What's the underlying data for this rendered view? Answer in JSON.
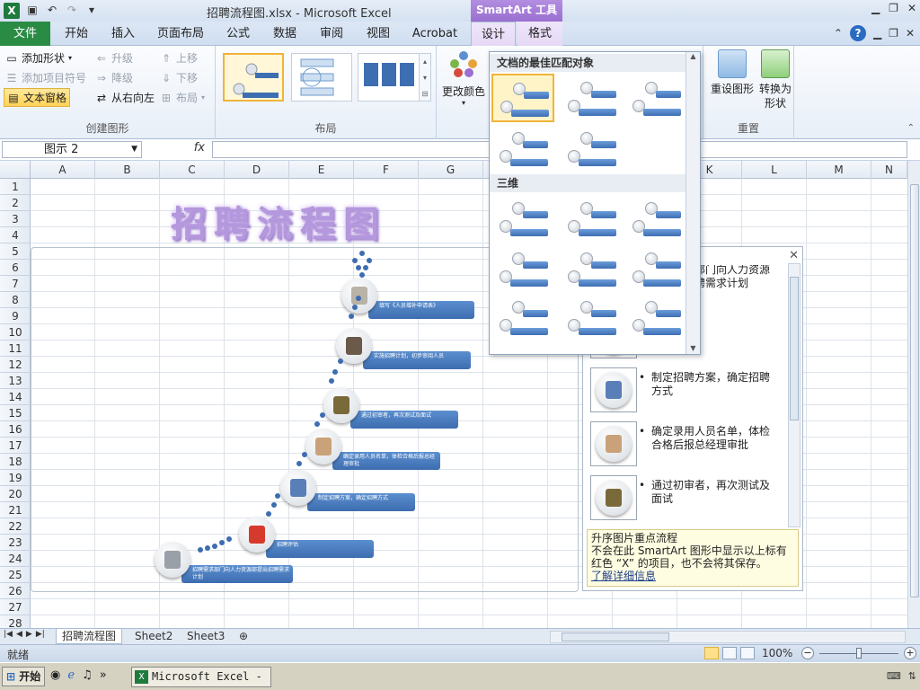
{
  "window": {
    "app_icon": "X",
    "title": "招聘流程图.xlsx  -  Microsoft Excel",
    "contextual_tab_group": "SmartArt 工具",
    "controls": [
      "minimize-icon",
      "restore-icon",
      "close-icon"
    ]
  },
  "quick_access": {
    "save": "save-icon",
    "undo": "undo-icon",
    "redo": "redo-icon",
    "customize": "dropdown-icon"
  },
  "tabs": {
    "file": "文件",
    "items": [
      "开始",
      "插入",
      "页面布局",
      "公式",
      "数据",
      "审阅",
      "视图",
      "Acrobat",
      "设计",
      "格式"
    ],
    "active": "设计"
  },
  "ribbon": {
    "create_graphic": {
      "label": "创建图形",
      "add_shape": "添加形状",
      "add_bullet": "添加项目符号",
      "text_pane": "文本窗格",
      "promote": "升级",
      "demote": "降级",
      "right_to_left": "从右向左",
      "move_up": "上移",
      "move_down": "下移",
      "layout": "布局"
    },
    "layouts": {
      "label": "布局"
    },
    "change_colors": "更改颜色",
    "reset": {
      "label": "重置",
      "reset_graphic": "重设图形",
      "convert_1": "转换为",
      "convert_2": "形状"
    }
  },
  "formula_bar": {
    "name_box": "图示 2",
    "fx": "fx",
    "value": ""
  },
  "grid": {
    "columns": [
      "A",
      "B",
      "C",
      "D",
      "E",
      "F",
      "G",
      "H",
      "I",
      "J",
      "K",
      "L",
      "M",
      "N"
    ],
    "rows": [
      "1",
      "2",
      "3",
      "4",
      "5",
      "6",
      "7",
      "8",
      "9",
      "10",
      "11",
      "12",
      "13",
      "14",
      "15",
      "16",
      "17",
      "18",
      "19",
      "20",
      "21",
      "22",
      "23",
      "24",
      "25",
      "26",
      "27",
      "28"
    ]
  },
  "wordart_title": "招聘流程图",
  "smartart": {
    "steps": [
      {
        "text": "招聘需求部门向人力资源部提出招聘需求计划",
        "color": "#9aa0a8"
      },
      {
        "text": "招聘评估",
        "color": "#d63a2c"
      },
      {
        "text": "制定招聘方案，确定招聘方式",
        "color": "#5a7fb8"
      },
      {
        "text": "确定录用人员名单，体检合格后报总经理审批",
        "color": "#c9a27a"
      },
      {
        "text": "通过初审者，再次测试及面试",
        "color": "#7a6a3a"
      },
      {
        "text": "实施招聘计划，初步审阅人员",
        "color": "#6b5a4a"
      },
      {
        "text": "填写《人员增补申请表》",
        "color": "#b9b2a6"
      }
    ]
  },
  "text_pane": {
    "items": [
      {
        "text": "招聘需求部门向人力资源部提出招聘需求计划",
        "color": "#9aa0a8"
      },
      {
        "text": "招聘评估",
        "color": "#d63a2c"
      },
      {
        "text": "制定招聘方案，确定招聘方式",
        "color": "#5a7fb8"
      },
      {
        "text": "确定录用人员名单，体检合格后报总经理审批",
        "color": "#c9a27a"
      },
      {
        "text": "通过初审者，再次测试及面试",
        "color": "#7a6a3a"
      }
    ],
    "info_title": "升序图片重点流程",
    "info_body": "不会在此 SmartArt 图形中显示以上标有红色 “X” 的项目，也不会将其保存。",
    "info_link": "了解详细信息"
  },
  "gallery": {
    "section_best": "文档的最佳匹配对象",
    "section_3d": "三维"
  },
  "sheets": {
    "tabs": [
      "招聘流程图",
      "Sheet2",
      "Sheet3"
    ],
    "active": "招聘流程图"
  },
  "status": {
    "text": "就绪",
    "zoom": "100%",
    "zoom_fraction": 0.5
  },
  "taskbar": {
    "start": "开始",
    "task": "Microsoft Excel - ..."
  }
}
